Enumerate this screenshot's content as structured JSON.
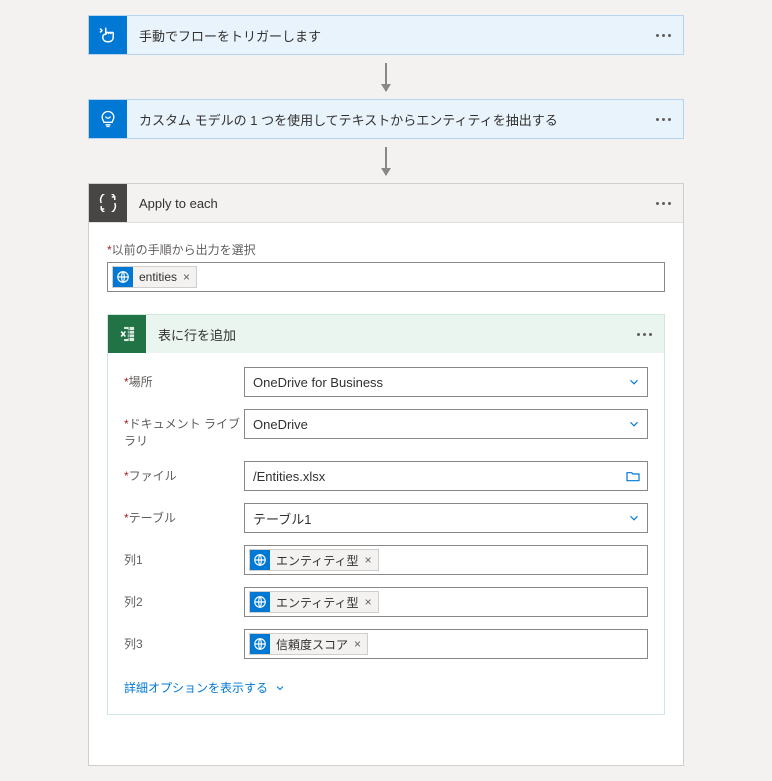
{
  "steps": {
    "trigger": {
      "title": "手動でフローをトリガーします"
    },
    "extract": {
      "title": "カスタム モデルの 1 つを使用してテキストからエンティティを抽出する"
    },
    "each": {
      "title": "Apply to each"
    }
  },
  "each": {
    "prev_output_label": "以前の手順から出力を選択",
    "token_entities": "entities"
  },
  "excel": {
    "title": "表に行を追加",
    "location_label": "場所",
    "location_value": "OneDrive for Business",
    "library_label": "ドキュメント ライブラリ",
    "library_value": "OneDrive",
    "file_label": "ファイル",
    "file_value": "/Entities.xlsx",
    "table_label": "テーブル",
    "table_value": "テーブル1",
    "col1_label": "列1",
    "col1_token": "エンティティ型",
    "col2_label": "列2",
    "col2_token": "エンティティ型",
    "col3_label": "列3",
    "col3_token": "信頼度スコア",
    "show_advanced": "詳細オプションを表示する"
  }
}
